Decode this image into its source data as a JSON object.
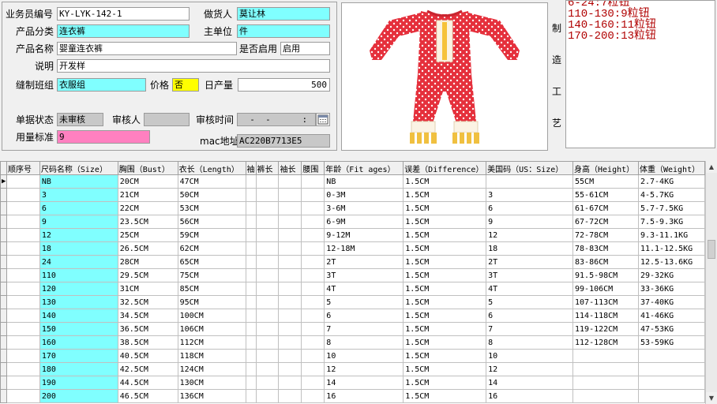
{
  "form": {
    "salesman_no_label": "业务员编号",
    "salesman_no_value": "KY-LYK-142-1",
    "maker_label": "做货人",
    "maker_value": "莫让林",
    "category_label": "产品分类",
    "category_value": "连衣裤",
    "main_unit_label": "主单位",
    "main_unit_value": "件",
    "product_name_label": "产品名称",
    "product_name_value": "婴童连衣裤",
    "enabled_label": "是否启用",
    "enabled_value": "启用",
    "note_label": "说明",
    "note_value": "开发样",
    "sewing_group_label": "缝制班组",
    "sewing_group_value": "衣服组",
    "price_label": "价格",
    "price_value": "否",
    "daily_output_label": "日产量",
    "daily_output_value": "500",
    "doc_status_label": "单据状态",
    "doc_status_value": "未审核",
    "auditor_label": "审核人",
    "auditor_value": "",
    "audit_time_label": "审核时间",
    "audit_time_value": "  -  -      :",
    "usage_label": "用量标准",
    "usage_value": "9",
    "mac_label": "mac地址",
    "mac_value": "AC220B7713E5"
  },
  "process": {
    "label_chars": [
      "制",
      "造",
      "工",
      "艺"
    ],
    "lines": [
      "6-24:7粒钮",
      "110-130:9粒钮",
      "140-160:11粒钮",
      "170-200:13粒钮"
    ]
  },
  "colors": {
    "cyan": "#80ffff",
    "yellow": "#ffff00",
    "pink": "#ff80c0",
    "process_text": "#b00000"
  },
  "table": {
    "headers": [
      "顺序号",
      "尺码名称（Size）",
      "胸围（Bust）",
      "衣长（Length）",
      "袖",
      "裤长",
      "袖长",
      "腰围",
      "年龄（Fit ages）",
      "误差（Difference）",
      "美国码（US：Size）",
      "身高（Height）",
      "体重（Weight）"
    ],
    "rows": [
      [
        "",
        "NB",
        "20CM",
        "47CM",
        "",
        "",
        "",
        "",
        "NB",
        "1.5CM",
        "",
        "55CM",
        "2.7-4KG"
      ],
      [
        "",
        "3",
        "21CM",
        "50CM",
        "",
        "",
        "",
        "",
        "0-3M",
        "1.5CM",
        "3",
        "55-61CM",
        "4-5.7KG"
      ],
      [
        "",
        "6",
        "22CM",
        "53CM",
        "",
        "",
        "",
        "",
        "3-6M",
        "1.5CM",
        "6",
        "61-67CM",
        "5.7-7.5KG"
      ],
      [
        "",
        "9",
        "23.5CM",
        "56CM",
        "",
        "",
        "",
        "",
        "6-9M",
        "1.5CM",
        "9",
        "67-72CM",
        "7.5-9.3KG"
      ],
      [
        "",
        "12",
        "25CM",
        "59CM",
        "",
        "",
        "",
        "",
        "9-12M",
        "1.5CM",
        "12",
        "72-78CM",
        "9.3-11.1KG"
      ],
      [
        "",
        "18",
        "26.5CM",
        "62CM",
        "",
        "",
        "",
        "",
        "12-18M",
        "1.5CM",
        "18",
        "78-83CM",
        "11.1-12.5KG"
      ],
      [
        "",
        "24",
        "28CM",
        "65CM",
        "",
        "",
        "",
        "",
        "2T",
        "1.5CM",
        "2T",
        "83-86CM",
        "12.5-13.6KG"
      ],
      [
        "",
        "110",
        "29.5CM",
        "75CM",
        "",
        "",
        "",
        "",
        "3T",
        "1.5CM",
        "3T",
        "91.5-98CM",
        "29-32KG"
      ],
      [
        "",
        "120",
        "31CM",
        "85CM",
        "",
        "",
        "",
        "",
        "4T",
        "1.5CM",
        "4T",
        "99-106CM",
        "33-36KG"
      ],
      [
        "",
        "130",
        "32.5CM",
        "95CM",
        "",
        "",
        "",
        "",
        "5",
        "1.5CM",
        "5",
        "107-113CM",
        "37-40KG"
      ],
      [
        "",
        "140",
        "34.5CM",
        "100CM",
        "",
        "",
        "",
        "",
        "6",
        "1.5CM",
        "6",
        "114-118CM",
        "41-46KG"
      ],
      [
        "",
        "150",
        "36.5CM",
        "106CM",
        "",
        "",
        "",
        "",
        "7",
        "1.5CM",
        "7",
        "119-122CM",
        "47-53KG"
      ],
      [
        "",
        "160",
        "38.5CM",
        "112CM",
        "",
        "",
        "",
        "",
        "8",
        "1.5CM",
        "8",
        "112-128CM",
        "53-59KG"
      ],
      [
        "",
        "170",
        "40.5CM",
        "118CM",
        "",
        "",
        "",
        "",
        "10",
        "1.5CM",
        "10",
        "",
        ""
      ],
      [
        "",
        "180",
        "42.5CM",
        "124CM",
        "",
        "",
        "",
        "",
        "12",
        "1.5CM",
        "12",
        "",
        ""
      ],
      [
        "",
        "190",
        "44.5CM",
        "130CM",
        "",
        "",
        "",
        "",
        "14",
        "1.5CM",
        "14",
        "",
        ""
      ],
      [
        "",
        "200",
        "46.5CM",
        "136CM",
        "",
        "",
        "",
        "",
        "16",
        "1.5CM",
        "16",
        "",
        ""
      ]
    ]
  }
}
